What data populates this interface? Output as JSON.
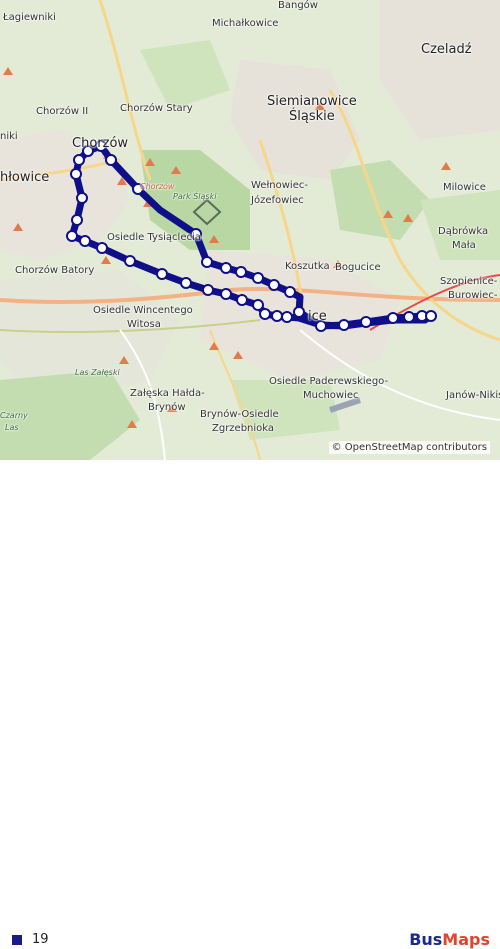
{
  "map": {
    "places": [
      {
        "key": "lagiewniki",
        "label": "Łagiewniki"
      },
      {
        "key": "bangow",
        "label": "Bangów"
      },
      {
        "key": "michalkowice",
        "label": "Michałkowice"
      },
      {
        "key": "czeladz",
        "label": "Czeladź"
      },
      {
        "key": "chorzow_ii",
        "label": "Chorzów II"
      },
      {
        "key": "chorzow_stary",
        "label": "Chorzów Stary"
      },
      {
        "key": "siemianowice_1",
        "label": "Siemianowice"
      },
      {
        "key": "siemianowice_2",
        "label": "Śląskie"
      },
      {
        "key": "niki",
        "label": "niki"
      },
      {
        "key": "chorzow",
        "label": "Chorzów"
      },
      {
        "key": "hlowice",
        "label": "hłowice"
      },
      {
        "key": "chorzow_route",
        "label": "Chorzów"
      },
      {
        "key": "park_slaski",
        "label": "Park Śląski"
      },
      {
        "key": "welnowiec_1",
        "label": "Wełnowiec-"
      },
      {
        "key": "welnowiec_2",
        "label": "Józefowiec"
      },
      {
        "key": "milowice",
        "label": "Milowice"
      },
      {
        "key": "osiedle_tysiaclecia",
        "label": "Osiedle Tysiąclecia"
      },
      {
        "key": "dabrowka_1",
        "label": "Dąbrówka"
      },
      {
        "key": "dabrowka_2",
        "label": "Mała"
      },
      {
        "key": "koszutka",
        "label": "Koszutka"
      },
      {
        "key": "bogucice",
        "label": "Bogucice"
      },
      {
        "key": "chorzow_batory",
        "label": "Chorzów Batory"
      },
      {
        "key": "szopienice_1",
        "label": "Szopienice-"
      },
      {
        "key": "szopienice_2",
        "label": "Burowiec-"
      },
      {
        "key": "wincentego_1",
        "label": "Osiedle Wincentego"
      },
      {
        "key": "wincentego_2",
        "label": "Witosa"
      },
      {
        "key": "ice",
        "label": "ice"
      },
      {
        "key": "las_zaleski",
        "label": "Las Załęski"
      },
      {
        "key": "paderewskiego_1",
        "label": "Osiedle Paderewskiego-"
      },
      {
        "key": "paderewskiego_2",
        "label": "Muchowiec"
      },
      {
        "key": "zaleska_1",
        "label": "Załęska Hałda-"
      },
      {
        "key": "zaleska_2",
        "label": "Brynów"
      },
      {
        "key": "janow",
        "label": "Janów-Nikis"
      },
      {
        "key": "brynow_1",
        "label": "Brynów-Osiedle"
      },
      {
        "key": "brynow_2",
        "label": "Zgrzebnioka"
      },
      {
        "key": "zarny",
        "label": "Czarny"
      },
      {
        "key": "las",
        "label": "Las"
      }
    ],
    "attribution": "© OpenStreetMap contributors",
    "route_color": "#0f0f8a"
  },
  "legend": {
    "route_label": "19",
    "route_color": "#1a1a8c"
  },
  "brand": {
    "part1": "Bus",
    "part2": "Maps"
  }
}
